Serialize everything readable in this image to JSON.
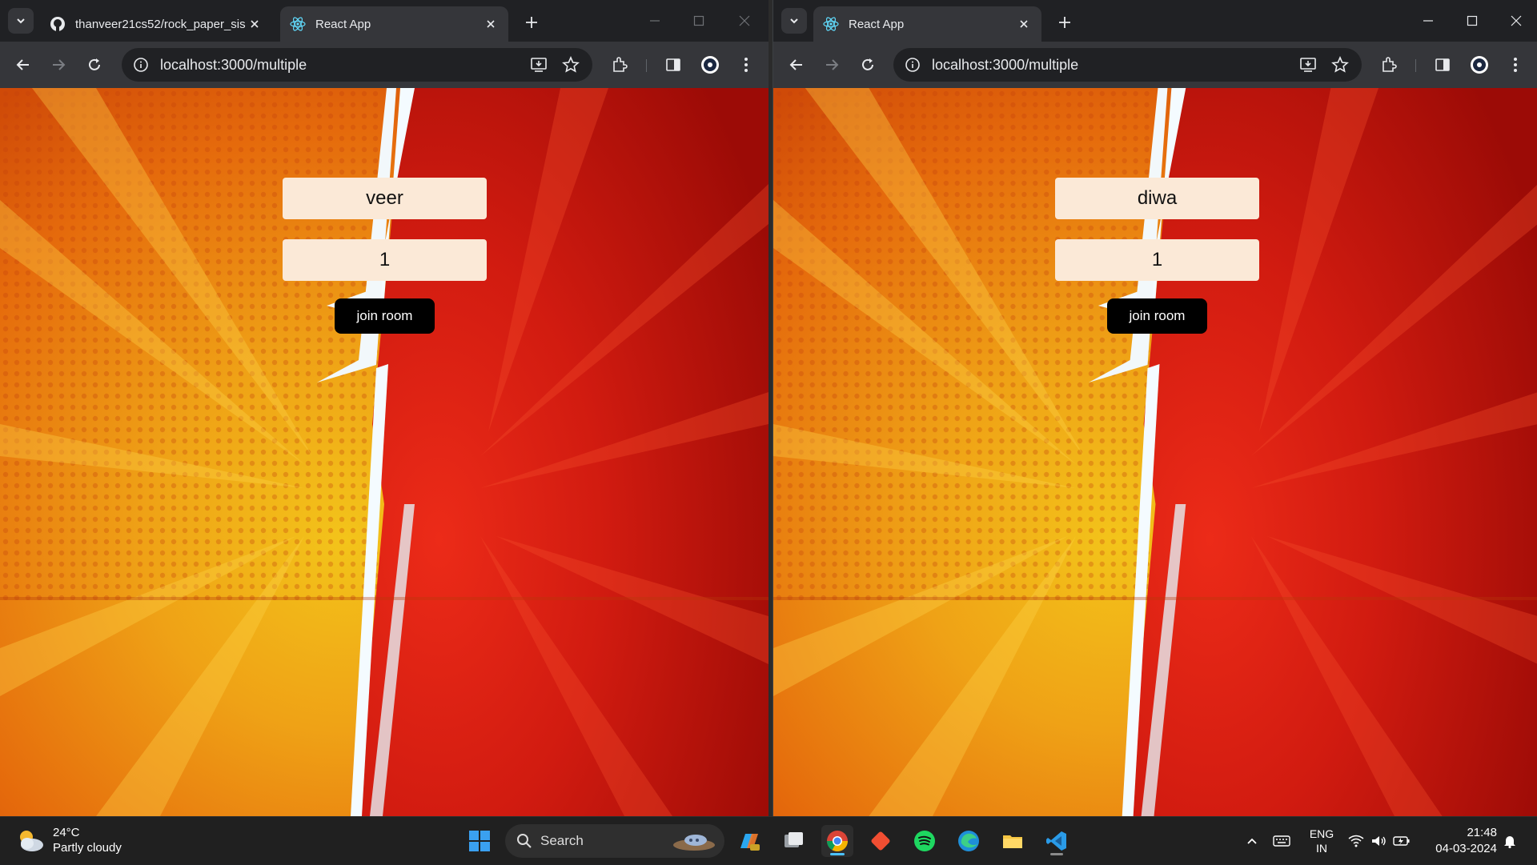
{
  "left_window": {
    "tabs": [
      {
        "title": "thanveer21cs52/rock_paper_sis",
        "favicon": "github-icon",
        "active": false
      },
      {
        "title": "React App",
        "favicon": "react-icon",
        "active": true
      }
    ],
    "url": "localhost:3000/multiple",
    "form": {
      "name_value": "veer",
      "room_value": "1",
      "join_label": "join room"
    }
  },
  "right_window": {
    "tabs": [
      {
        "title": "React App",
        "favicon": "react-icon",
        "active": true
      }
    ],
    "url": "localhost:3000/multiple",
    "form": {
      "name_value": "diwa",
      "room_value": "1",
      "join_label": "join room"
    }
  },
  "taskbar": {
    "weather": {
      "temp": "24°C",
      "condition": "Partly cloudy"
    },
    "search_label": "Search",
    "apps": [
      "windows-start-icon",
      "copilot-icon",
      "task-view-icon",
      "chrome-icon",
      "git-icon",
      "spotify-icon",
      "edge-icon",
      "file-explorer-icon",
      "vscode-icon"
    ],
    "language": {
      "line1": "ENG",
      "line2": "IN"
    },
    "clock": {
      "time": "21:48",
      "date": "04-03-2024"
    }
  },
  "colors": {
    "chrome_dark": "#202124",
    "chrome_toolbar": "#35363a",
    "bg_orange": "#f0a51c",
    "bg_red": "#c8160e",
    "input_bg": "#fbe9d7",
    "button_bg": "#000000"
  }
}
